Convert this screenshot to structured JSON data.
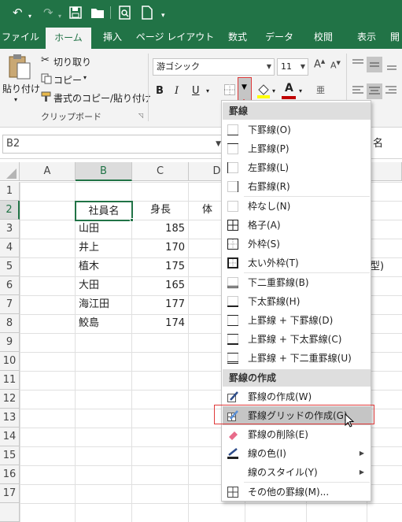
{
  "qat": {
    "undo_icon": "undo-icon",
    "redo_icon": "redo-icon",
    "save_icon": "save-icon",
    "open_icon": "open-folder-icon",
    "preview_icon": "print-preview-icon",
    "new_icon": "new-document-icon"
  },
  "tabs": [
    "ファイル",
    "ホーム",
    "挿入",
    "ページ レイアウト",
    "数式",
    "データ",
    "校閲",
    "表示",
    "開"
  ],
  "ribbon": {
    "paste": "貼り付け",
    "cut": "切り取り",
    "copy": "コピー",
    "format_painter": "書式のコピー/貼り付け",
    "clipboard_group": "クリップボード",
    "font_name": "游ゴシック",
    "font_size": "11",
    "bold": "B",
    "italic": "I",
    "underline": "U",
    "font_color_letter": "A",
    "colors": {
      "font_underline": "#c00000",
      "highlight": "#ffff00",
      "accent": "#217346",
      "annotation": "#e03a3a"
    }
  },
  "formula_bar": {
    "name_box": "B2",
    "right_text": "名"
  },
  "sheet": {
    "columns": [
      "A",
      "B",
      "C",
      "D"
    ],
    "rows": [
      "1",
      "2",
      "3",
      "4",
      "5",
      "6",
      "7",
      "8",
      "9",
      "10",
      "11",
      "12",
      "13",
      "14",
      "15",
      "16",
      "17"
    ],
    "headers": [
      "社員名",
      "身長",
      "体"
    ],
    "names": [
      "山田",
      "井上",
      "植木",
      "大田",
      "海江田",
      "鮫島"
    ],
    "heights": [
      "185",
      "170",
      "175",
      "165",
      "177",
      "174"
    ],
    "partial_text": "型)"
  },
  "menu": {
    "section1": "罫線",
    "items1": [
      "下罫線(O)",
      "上罫線(P)",
      "左罫線(L)",
      "右罫線(R)"
    ],
    "items2": [
      "枠なし(N)",
      "格子(A)",
      "外枠(S)",
      "太い外枠(T)"
    ],
    "items3": [
      "下二重罫線(B)",
      "下太罫線(H)",
      "上罫線 + 下罫線(D)",
      "上罫線 + 下太罫線(C)",
      "上罫線 + 下二重罫線(U)"
    ],
    "section2": "罫線の作成",
    "items4": [
      "罫線の作成(W)",
      "罫線グリッドの作成(G)",
      "罫線の削除(E)",
      "線の色(I)",
      "線のスタイル(Y)"
    ],
    "items5": [
      "その他の罫線(M)..."
    ]
  }
}
